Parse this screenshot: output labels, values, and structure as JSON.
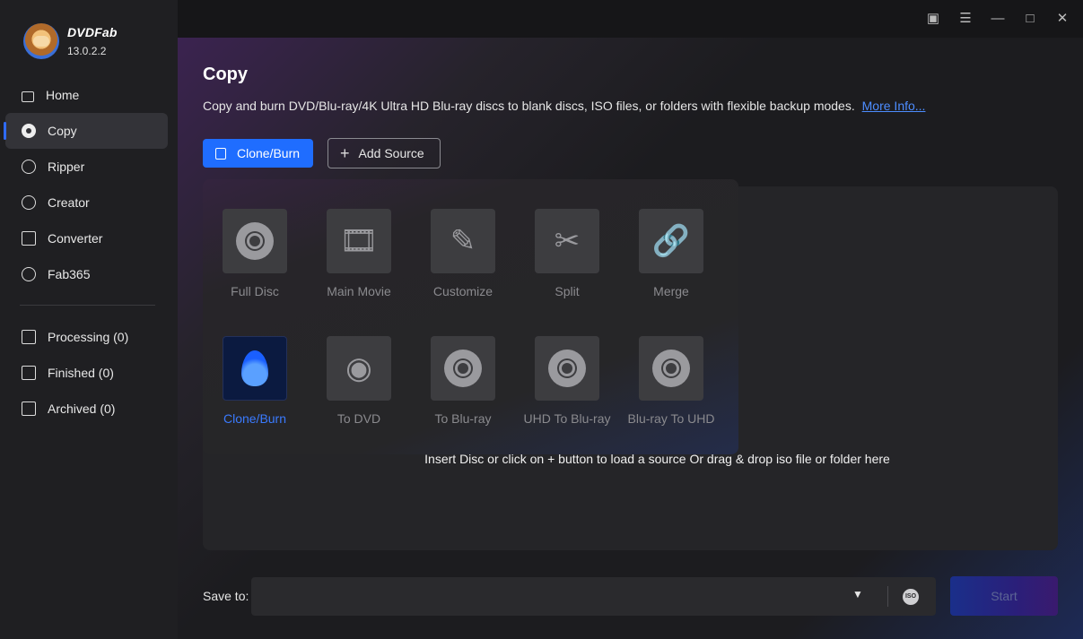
{
  "app": {
    "name": "DVDFab",
    "version": "13.0.2.2"
  },
  "sidebar": {
    "items": [
      {
        "label": "Home",
        "icon": "home-icon"
      },
      {
        "label": "Copy",
        "icon": "copy-disc-icon"
      },
      {
        "label": "Ripper",
        "icon": "ripper-icon"
      },
      {
        "label": "Creator",
        "icon": "creator-icon"
      },
      {
        "label": "Converter",
        "icon": "converter-icon"
      },
      {
        "label": "Fab365",
        "icon": "fab365-icon"
      }
    ],
    "queue": [
      {
        "label": "Processing (0)",
        "icon": "processing-icon"
      },
      {
        "label": "Finished (0)",
        "icon": "finished-icon"
      },
      {
        "label": "Archived (0)",
        "icon": "archived-icon"
      }
    ]
  },
  "titlebar": {
    "icons": [
      "skin-icon",
      "menu-icon",
      "minimize-icon",
      "maximize-icon",
      "close-icon"
    ]
  },
  "main": {
    "title": "Copy",
    "description": "Copy and burn DVD/Blu-ray/4K Ultra HD Blu-ray discs to blank discs, ISO files, or folders with flexible backup modes.",
    "more_info": "More Info...",
    "mode_button": "Clone/Burn",
    "add_source": "Add Source",
    "drop_hint": "Insert Disc or click on + button to load a source Or drag & drop iso file or folder here",
    "modes_row1": [
      "Full Disc",
      "Main Movie",
      "Customize",
      "Split",
      "Merge"
    ],
    "modes_row2": [
      "Clone/Burn",
      "To DVD",
      "To Blu-ray",
      "UHD To Blu-ray",
      "Blu-ray To UHD"
    ],
    "selected_mode": "Clone/Burn"
  },
  "bottom": {
    "save_to_label": "Save to:",
    "save_to_value": "",
    "iso_label": "ISO",
    "start": "Start"
  },
  "colors": {
    "accent": "#1f6dff",
    "selected_text": "#3a7bff",
    "sidebar_bg": "#1f1f22"
  }
}
